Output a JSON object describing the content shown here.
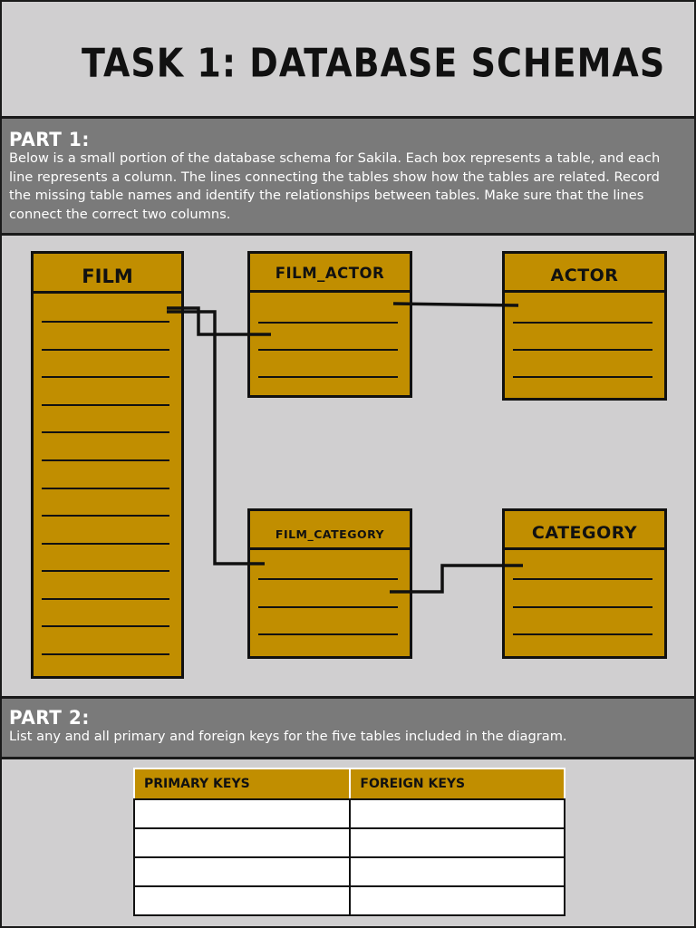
{
  "title": "TASK 1: DATABASE SCHEMAS",
  "part1": {
    "heading": "PART 1:",
    "text": "Below is a small portion of the database schema for Sakila. Each box represents a table, and each line represents a column. The lines connecting the tables show how the tables are related. Record the missing table names and identify the relationships between tables. Make sure that the lines connect the correct two columns."
  },
  "diagram": {
    "tables": [
      {
        "id": "film",
        "name": "FILM",
        "columns": 13
      },
      {
        "id": "film_actor",
        "name": "FILM_ACTOR",
        "columns": 3
      },
      {
        "id": "actor",
        "name": "ACTOR",
        "columns": 3
      },
      {
        "id": "film_category",
        "name": "FILM_CATEGORY",
        "columns": 3
      },
      {
        "id": "category",
        "name": "CATEGORY",
        "columns": 3
      }
    ]
  },
  "part2": {
    "heading": "PART 2:",
    "text": "List  any and all primary and foreign keys for the five tables included in the diagram."
  },
  "keys_table": {
    "headers": [
      "PRIMARY KEYS",
      "FOREIGN KEYS"
    ],
    "rows": 4
  },
  "colors": {
    "table_fill": "#c18e00",
    "band_gray": "#7a7a7a",
    "page_bg": "#d0cfd0"
  }
}
